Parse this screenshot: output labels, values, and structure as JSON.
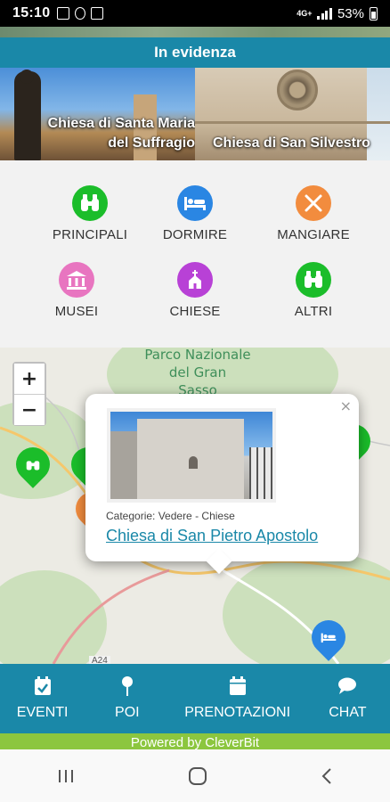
{
  "status_bar": {
    "time": "15:10",
    "network": "4G+",
    "battery": "53%"
  },
  "featured": {
    "title": "In evidenza",
    "slides": [
      {
        "caption_line1": "Chiesa di Santa Maria",
        "caption_line2": "del Suffragio"
      },
      {
        "caption_line1": "Chiesa di San Silvestro",
        "caption_line2": ""
      }
    ]
  },
  "categories": [
    {
      "label": "PRINCIPALI",
      "icon": "binoculars-icon",
      "color": "#1bbd2a"
    },
    {
      "label": "DORMIRE",
      "icon": "bed-icon",
      "color": "#2a86e3"
    },
    {
      "label": "MANGIARE",
      "icon": "fork-knife-icon",
      "color": "#f28c3e"
    },
    {
      "label": "MUSEI",
      "icon": "museum-icon",
      "color": "#e875c0"
    },
    {
      "label": "CHIESE",
      "icon": "church-icon",
      "color": "#b841d6"
    },
    {
      "label": "ALTRI",
      "icon": "binoculars-icon",
      "color": "#1bbd2a"
    }
  ],
  "map": {
    "park_label_line1": "Parco Nazionale",
    "park_label_line2": "del Gran",
    "park_label_line3": "Sasso",
    "road_label": "A24",
    "zoom_in": "+",
    "zoom_out": "−",
    "popup": {
      "close": "×",
      "category": "Categorie: Vedere - Chiese",
      "title": "Chiesa di San Pietro Apostolo"
    }
  },
  "bottom_nav": [
    {
      "label": "EVENTI",
      "icon": "calendar-check-icon"
    },
    {
      "label": "POI",
      "icon": "pin-icon"
    },
    {
      "label": "PRENOTAZIONI",
      "icon": "calendar-icon"
    },
    {
      "label": "CHAT",
      "icon": "chat-bubble-icon"
    }
  ],
  "footer": {
    "powered_by": "Powered by CleverBit"
  },
  "colors": {
    "primary": "#1a88a8",
    "footer_green": "#8cc63f",
    "link": "#1a88a8"
  }
}
